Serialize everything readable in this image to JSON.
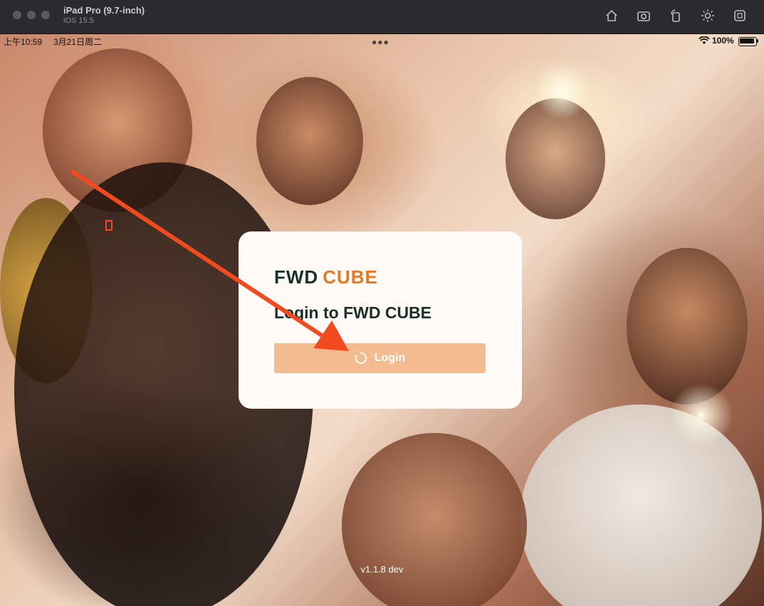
{
  "simulator": {
    "device": "iPad Pro (9.7-inch)",
    "os": "iOS 15.5",
    "toolbar_icons": [
      "home-icon",
      "screenshot-icon",
      "rotate-icon",
      "brightness-icon",
      "shortcut-icon"
    ]
  },
  "statusbar": {
    "time": "上午10:59",
    "date": "3月21日周二",
    "battery": "100%"
  },
  "login": {
    "logo_left": "FWD",
    "logo_right": "CUBE",
    "title": "Login to FWD CUBE",
    "button_label": "Login"
  },
  "version": "v1.1.8 dev",
  "colors": {
    "brand_green": "#183028",
    "brand_orange": "#e87722",
    "button_bg": "#f3bb90",
    "arrow": "#f04a1e"
  }
}
